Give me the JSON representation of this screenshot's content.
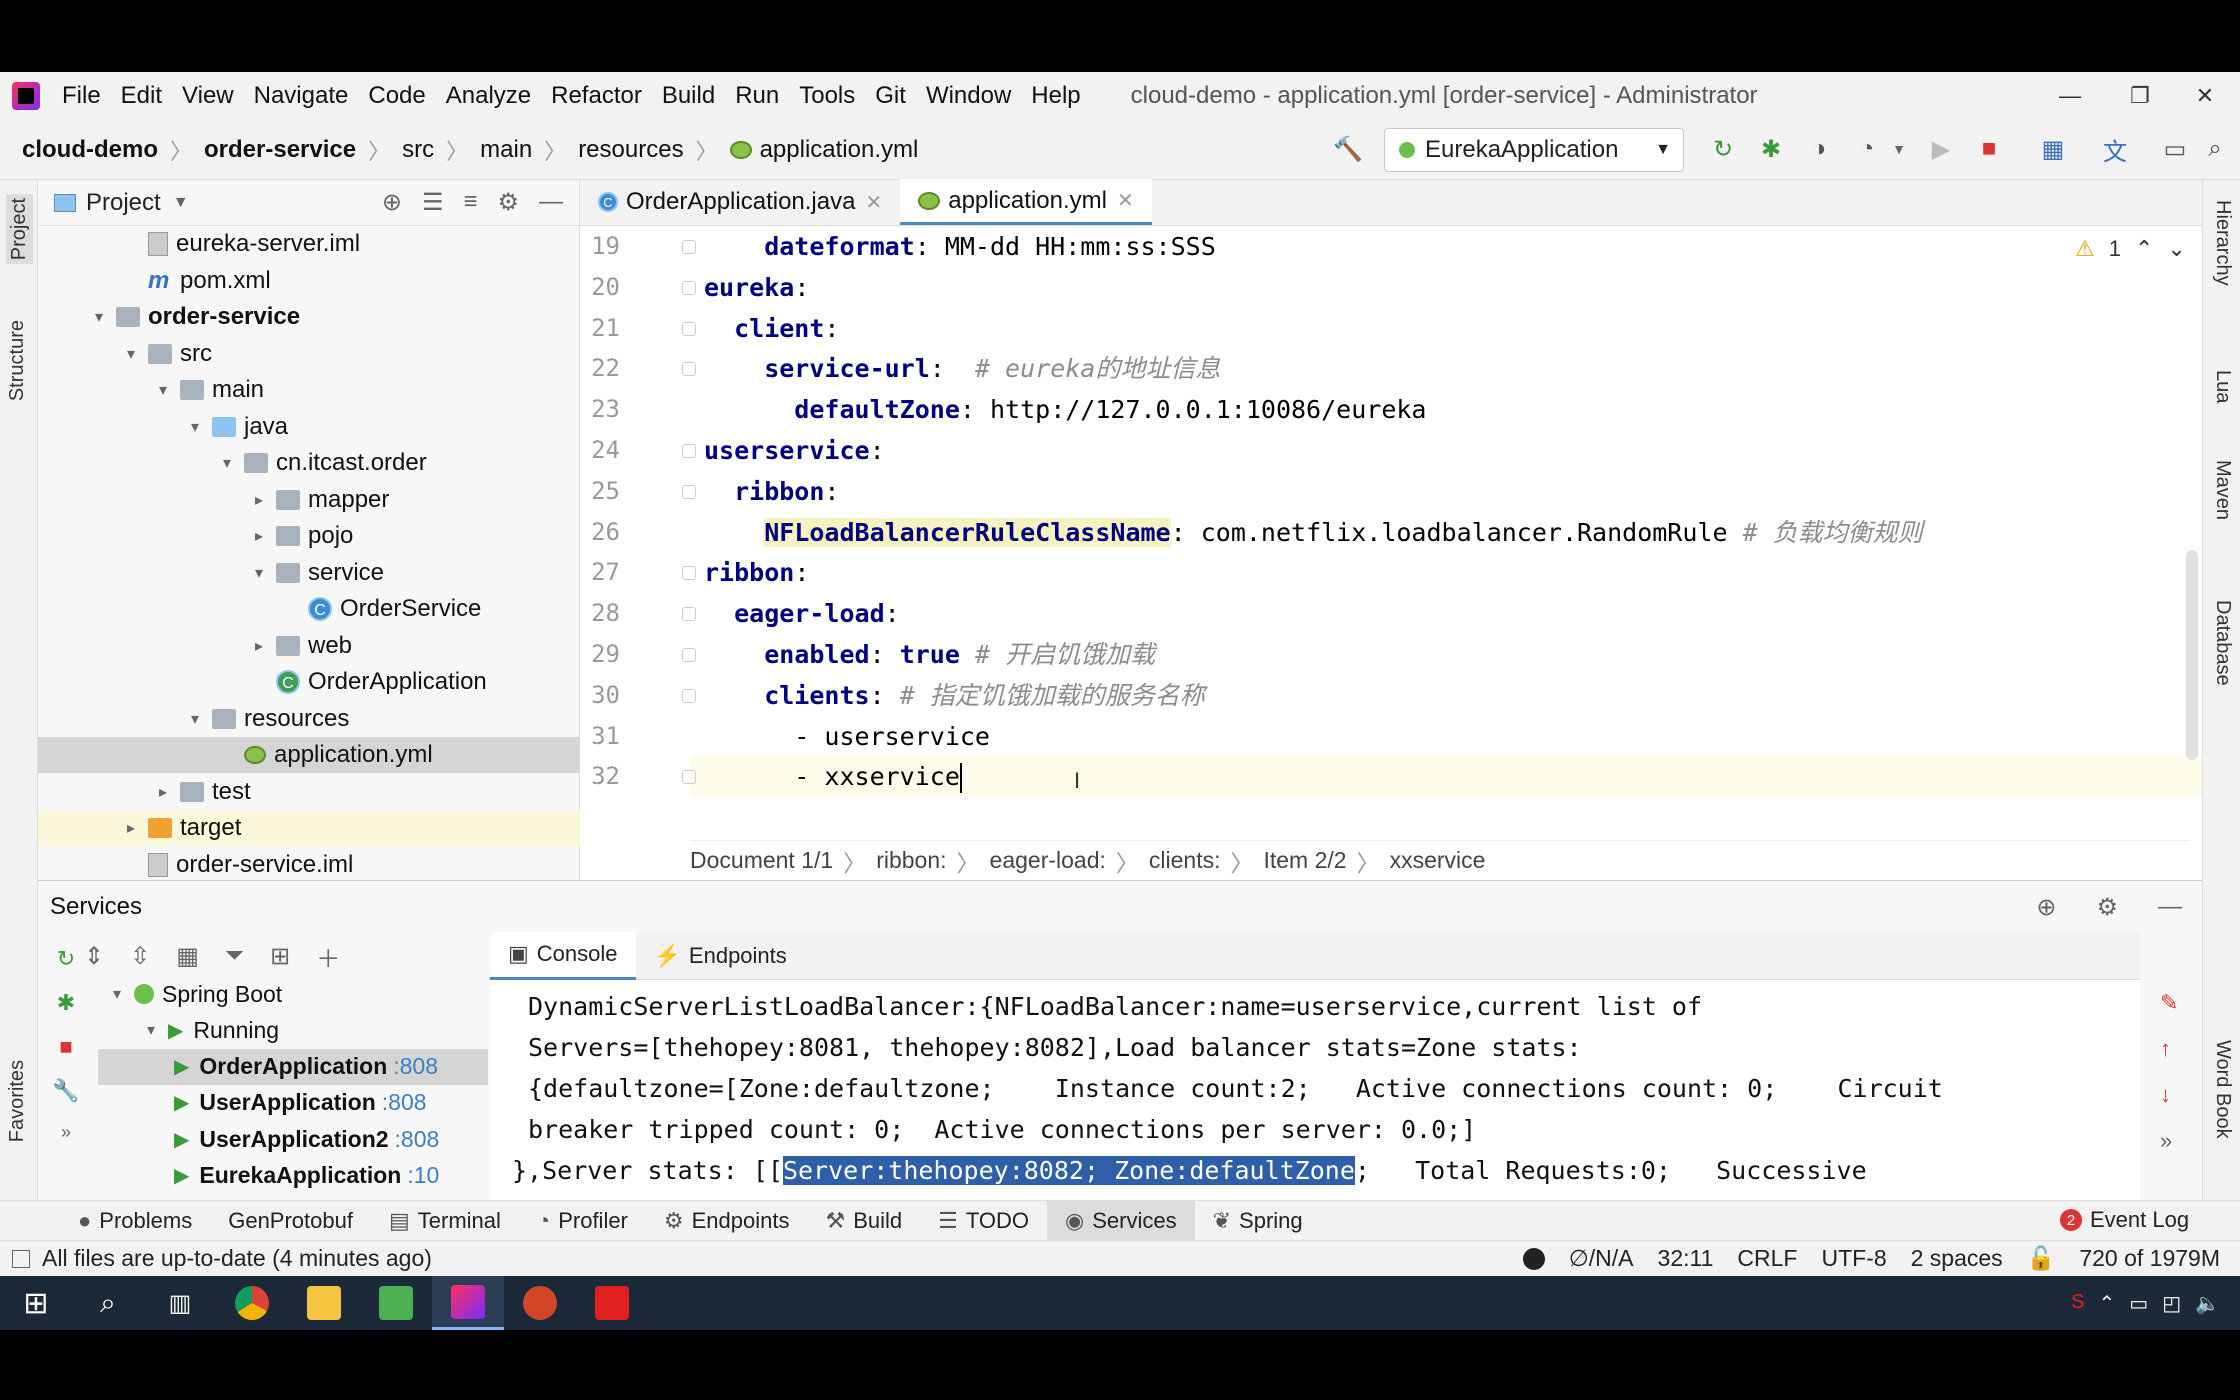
{
  "app": {
    "menu": [
      "File",
      "Edit",
      "View",
      "Navigate",
      "Code",
      "Analyze",
      "Refactor",
      "Build",
      "Run",
      "Tools",
      "Git",
      "Window",
      "Help"
    ],
    "window_title": "cloud-demo - application.yml [order-service] - Administrator",
    "win_controls": [
      "—",
      "❐",
      "✕"
    ]
  },
  "breadcrumb": [
    "cloud-demo",
    "order-service",
    "src",
    "main",
    "resources",
    "application.yml"
  ],
  "run_config": "EurekaApplication",
  "left_strip": [
    "Project",
    "Structure",
    "Favorites"
  ],
  "right_strip": [
    "Hierarchy",
    "Lua",
    "Maven",
    "Database",
    "Word Book"
  ],
  "project": {
    "header": "Project",
    "tree": [
      {
        "label": "eureka-server.iml",
        "icon": "iml-file-icon",
        "depth": 2,
        "arrow": ""
      },
      {
        "label": "pom.xml",
        "icon": "maven-file-icon",
        "depth": 2,
        "arrow": ""
      },
      {
        "label": "order-service",
        "icon": "module-folder-icon",
        "depth": 1,
        "arrow": "▾",
        "bold": true
      },
      {
        "label": "src",
        "icon": "folder-icon",
        "depth": 2,
        "arrow": "▾"
      },
      {
        "label": "main",
        "icon": "folder-icon",
        "depth": 3,
        "arrow": "▾"
      },
      {
        "label": "java",
        "icon": "source-folder-icon",
        "depth": 4,
        "arrow": "▾"
      },
      {
        "label": "cn.itcast.order",
        "icon": "package-icon",
        "depth": 5,
        "arrow": "▾"
      },
      {
        "label": "mapper",
        "icon": "package-icon",
        "depth": 6,
        "arrow": "▸"
      },
      {
        "label": "pojo",
        "icon": "package-icon",
        "depth": 6,
        "arrow": "▸"
      },
      {
        "label": "service",
        "icon": "package-icon",
        "depth": 6,
        "arrow": "▾"
      },
      {
        "label": "OrderService",
        "icon": "class-icon",
        "depth": 7,
        "arrow": ""
      },
      {
        "label": "web",
        "icon": "package-icon",
        "depth": 6,
        "arrow": "▸"
      },
      {
        "label": "OrderApplication",
        "icon": "spring-class-icon",
        "depth": 6,
        "arrow": ""
      },
      {
        "label": "resources",
        "icon": "resources-folder-icon",
        "depth": 4,
        "arrow": "▾"
      },
      {
        "label": "application.yml",
        "icon": "yml-file-icon",
        "depth": 5,
        "arrow": "",
        "selected": true
      },
      {
        "label": "test",
        "icon": "folder-icon",
        "depth": 3,
        "arrow": "▸"
      },
      {
        "label": "target",
        "icon": "target-folder-icon",
        "depth": 2,
        "arrow": "▸",
        "highlight": true
      },
      {
        "label": "order-service.iml",
        "icon": "iml-file-icon",
        "depth": 2,
        "arrow": ""
      }
    ]
  },
  "editor": {
    "tabs": [
      {
        "label": "OrderApplication.java",
        "active": false
      },
      {
        "label": "application.yml",
        "active": true
      }
    ],
    "warning_count": "1",
    "lines": [
      {
        "n": "19",
        "parts": [
          [
            "k",
            "    dateformat"
          ],
          [
            "p",
            ": "
          ],
          [
            "s",
            "MM-dd HH:mm:ss:SSS"
          ]
        ]
      },
      {
        "n": "20",
        "parts": [
          [
            "k",
            "eureka"
          ],
          [
            "p",
            ":"
          ]
        ]
      },
      {
        "n": "21",
        "parts": [
          [
            "k",
            "  client"
          ],
          [
            "p",
            ":"
          ]
        ]
      },
      {
        "n": "22",
        "parts": [
          [
            "k",
            "    service-url"
          ],
          [
            "p",
            ":  "
          ],
          [
            "c",
            "# eureka的地址信息"
          ]
        ]
      },
      {
        "n": "23",
        "parts": [
          [
            "k",
            "      defaultZone"
          ],
          [
            "p",
            ": "
          ],
          [
            "s",
            "http://127.0.0.1:10086/eureka"
          ]
        ]
      },
      {
        "n": "24",
        "parts": [
          [
            "k",
            "userservice"
          ],
          [
            "p",
            ":"
          ]
        ]
      },
      {
        "n": "25",
        "parts": [
          [
            "k",
            "  ribbon"
          ],
          [
            "p",
            ":"
          ]
        ]
      },
      {
        "n": "26",
        "parts": [
          [
            "p",
            "    "
          ],
          [
            "kh",
            "NFLoadBalancerRuleClassName"
          ],
          [
            "p",
            ": "
          ],
          [
            "s",
            "com.netflix.loadbalancer.RandomRule "
          ],
          [
            "c",
            "# 负载均衡规则"
          ]
        ]
      },
      {
        "n": "27",
        "parts": [
          [
            "k",
            "ribbon"
          ],
          [
            "p",
            ":"
          ]
        ]
      },
      {
        "n": "28",
        "parts": [
          [
            "k",
            "  eager-load"
          ],
          [
            "p",
            ":"
          ]
        ]
      },
      {
        "n": "29",
        "parts": [
          [
            "k",
            "    enabled"
          ],
          [
            "p",
            ": "
          ],
          [
            "b",
            "true"
          ],
          [
            "p",
            " "
          ],
          [
            "c",
            "# 开启饥饿加载"
          ]
        ]
      },
      {
        "n": "30",
        "parts": [
          [
            "k",
            "    clients"
          ],
          [
            "p",
            ": "
          ],
          [
            "c",
            "# 指定饥饿加载的服务名称"
          ]
        ]
      },
      {
        "n": "31",
        "parts": [
          [
            "p",
            "      - "
          ],
          [
            "s",
            "userservice"
          ]
        ]
      },
      {
        "n": "32",
        "parts": [
          [
            "p",
            "      - "
          ],
          [
            "s",
            "xxservice"
          ]
        ]
      }
    ],
    "crumbs": [
      "Document 1/1",
      "ribbon:",
      "eager-load:",
      "clients:",
      "Item 2/2",
      "xxservice"
    ]
  },
  "services": {
    "title": "Services",
    "tree": [
      {
        "label": "Spring Boot",
        "depth": 0,
        "arrow": "▾",
        "bold": false
      },
      {
        "label": "Running",
        "depth": 1,
        "arrow": "▾",
        "bold": false
      },
      {
        "label": "OrderApplication",
        "port": ":808",
        "depth": 2,
        "bold": true,
        "selected": true
      },
      {
        "label": "UserApplication",
        "port": ":808",
        "depth": 2,
        "bold": true
      },
      {
        "label": "UserApplication2",
        "port": ":808",
        "depth": 2,
        "bold": true
      },
      {
        "label": "EurekaApplication",
        "port": ":10",
        "depth": 2,
        "bold": true
      }
    ],
    "console_tabs": [
      "Console",
      "Endpoints"
    ],
    "console_lines": [
      "DynamicServerListLoadBalancer:{NFLoadBalancer:name=userservice,current list of",
      "Servers=[thehopey:8081, thehopey:8082],Load balancer stats=Zone stats:",
      "{defaultzone=[Zone:defaultzone;    Instance count:2;   Active connections count: 0;    Circuit",
      "breaker tripped count: 0;  Active connections per server: 0.0;]"
    ],
    "console_last": {
      "pre": "},Server stats: [[",
      "sel": "Server:thehopey:8082; Zone:defaultZone",
      "post": ";   Total Requests:0;   Successive"
    }
  },
  "bottom_tabs": [
    {
      "label": "Problems",
      "icon": "problems-icon"
    },
    {
      "label": "GenProtobuf",
      "icon": ""
    },
    {
      "label": "Terminal",
      "icon": "terminal-icon"
    },
    {
      "label": "Profiler",
      "icon": "profiler-icon"
    },
    {
      "label": "Endpoints",
      "icon": "endpoints-icon"
    },
    {
      "label": "Build",
      "icon": "build-icon"
    },
    {
      "label": "TODO",
      "icon": "todo-icon"
    },
    {
      "label": "Services",
      "icon": "services-icon",
      "active": true
    },
    {
      "label": "Spring",
      "icon": "spring-icon"
    }
  ],
  "event_log": {
    "count": "2",
    "label": "Event Log"
  },
  "status": {
    "message": "All files are up-to-date (4 minutes ago)",
    "vcs": "∅/N/A",
    "position": "32:11",
    "line_sep": "CRLF",
    "encoding": "UTF-8",
    "indent": "2 spaces",
    "memory": "720 of 1979M"
  },
  "colors": {
    "accent": "#4a88c7",
    "selection": "#2e5fa8",
    "taskbar": "#1c2938"
  }
}
